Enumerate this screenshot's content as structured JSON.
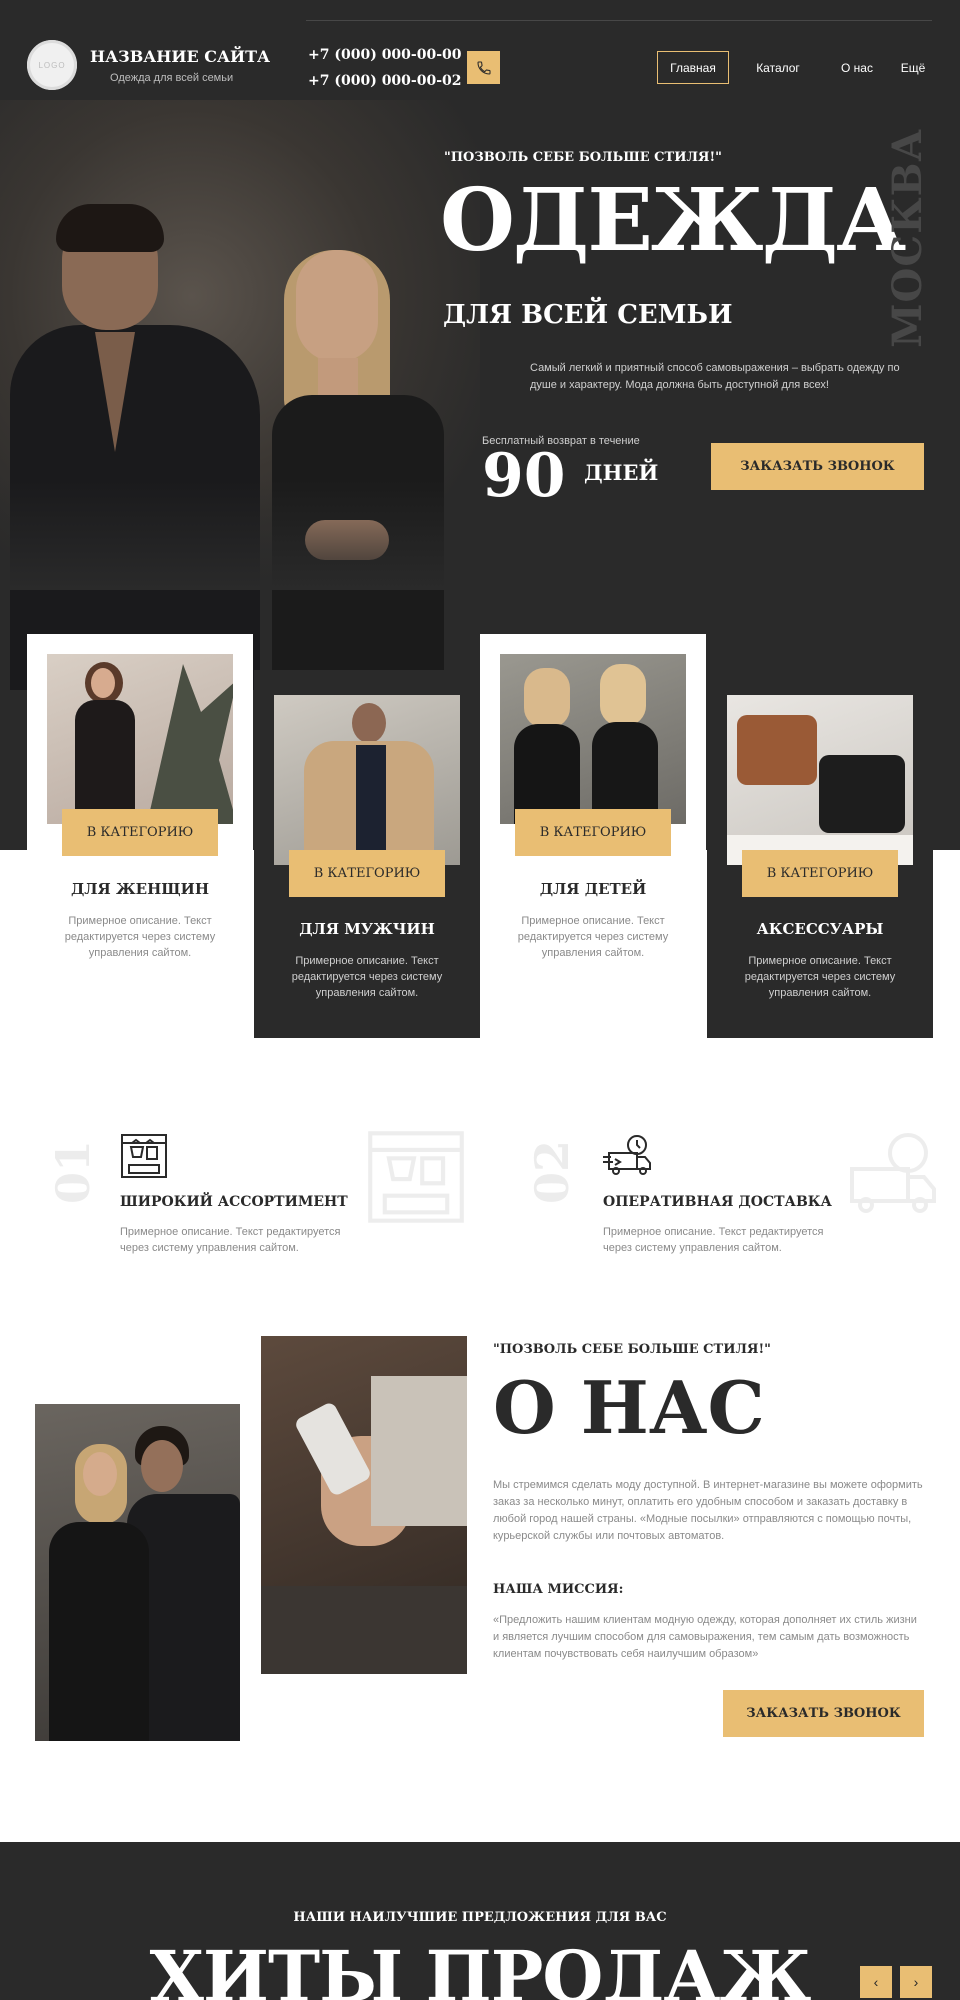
{
  "header": {
    "logo_text": "LOGO",
    "site_name": "НАЗВАНИЕ САЙТА",
    "tagline": "Одежда для всей семьи",
    "phones": [
      "+7 (000) 000-00-00",
      "+7 (000) 000-00-02"
    ],
    "phone_icon": "phone-icon",
    "nav": [
      "Главная",
      "Каталог",
      "О нас",
      "Ещё"
    ],
    "active_nav": "Главная"
  },
  "hero": {
    "slogan": "\"ПОЗВОЛЬ СЕБЕ БОЛЬШЕ СТИЛЯ!\"",
    "title": "ОДЕЖДА",
    "subtitle": "ДЛЯ ВСЕЙ СЕМЬИ",
    "city": "МОСКВА",
    "description": "Самый легкий и приятный способ самовыражения – выбрать одежду по душе и характеру. Мода должна быть доступной для всех!",
    "return_label": "Бесплатный возврат в течение",
    "return_number": "90",
    "return_unit": "ДНЕЙ",
    "cta": "ЗАКАЗАТЬ ЗВОНОК"
  },
  "categories": [
    {
      "title": "ДЛЯ ЖЕНЩИН",
      "button": "В КАТЕГОРИЮ",
      "description": "Примерное описание. Текст редактируется через систему управления сайтом."
    },
    {
      "title": "ДЛЯ МУЖЧИН",
      "button": "В КАТЕГОРИЮ",
      "description": "Примерное описание. Текст редактируется через систему управления сайтом."
    },
    {
      "title": "ДЛЯ ДЕТЕЙ",
      "button": "В КАТЕГОРИЮ",
      "description": "Примерное описание. Текст редактируется через систему управления сайтом."
    },
    {
      "title": "АКСЕССУАРЫ",
      "button": "В КАТЕГОРИЮ",
      "description": "Примерное описание. Текст редактируется через систему управления сайтом."
    }
  ],
  "features": [
    {
      "number": "01",
      "icon": "clothes-rack-icon",
      "title": "ШИРОКИЙ АССОРТИМЕНТ",
      "description": "Примерное описание. Текст редактируется через систему управления сайтом."
    },
    {
      "number": "02",
      "icon": "delivery-truck-icon",
      "title": "ОПЕРАТИВНАЯ ДОСТАВКА",
      "description": "Примерное описание. Текст редактируется через систему управления сайтом."
    }
  ],
  "about": {
    "slogan": "\"ПОЗВОЛЬ СЕБЕ БОЛЬШЕ СТИЛЯ!\"",
    "title": "О НАС",
    "text": "Мы стремимся сделать моду доступной. В интернет-магазине вы можете оформить заказ за несколько минут, оплатить его удобным способом и заказать доставку в любой город нашей страны. «Модные посылки» отправляются с помощью почты, курьерской службы или почтовых автоматов.",
    "mission_title": "НАША МИССИЯ:",
    "mission_text": "«Предложить нашим клиентам модную одежду, которая дополняет их стиль жизни и является лучшим способом для самовыражения, тем самым дать возможность клиентам почувствовать себя наилучшим образом»",
    "cta": "ЗАКАЗАТЬ ЗВОНОК"
  },
  "hits": {
    "subtitle": "НАШИ НАИЛУЧШИЕ ПРЕДЛОЖЕНИЯ ДЛЯ ВАС",
    "title": "ХИТЫ ПРОДАЖ",
    "prev": "‹",
    "next": "›"
  },
  "colors": {
    "accent": "#e9be73",
    "dark": "#2a2a2a",
    "light": "#ffffff",
    "muted": "#8a8a8a"
  }
}
